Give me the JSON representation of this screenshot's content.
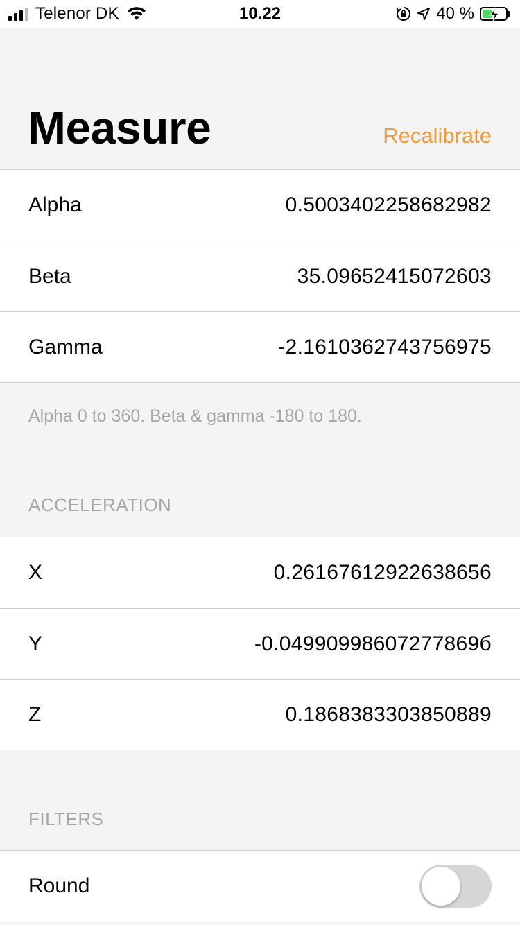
{
  "status_bar": {
    "carrier": "Telenor DK",
    "time": "10.22",
    "battery_percent": "40 %",
    "battery_level": 0.4,
    "signal_bars": 4,
    "signal_bars_filled": 3
  },
  "header": {
    "title": "Measure",
    "recalibrate_label": "Recalibrate"
  },
  "orientation": {
    "rows": [
      {
        "label": "Alpha",
        "value": "0.5003402258682982"
      },
      {
        "label": "Beta",
        "value": "35.09652415072603"
      },
      {
        "label": "Gamma",
        "value": "-2.1610362743756975"
      }
    ],
    "footer": "Alpha 0 to 360. Beta & gamma -180 to 180."
  },
  "acceleration": {
    "header": "ACCELERATION",
    "rows": [
      {
        "label": "X",
        "value": "0.26167612922638656"
      },
      {
        "label": "Y",
        "value": "-0.04990998607277869б"
      },
      {
        "label": "Z",
        "value": "0.1868383303850889"
      }
    ]
  },
  "filters": {
    "header": "FILTERS",
    "rows": [
      {
        "label": "Round",
        "enabled": false
      }
    ]
  },
  "colors": {
    "accent": "#f19a38",
    "secondary_text": "#a6a6a6",
    "background": "#f4f4f4",
    "toggle_off": "#d6d6d6"
  }
}
